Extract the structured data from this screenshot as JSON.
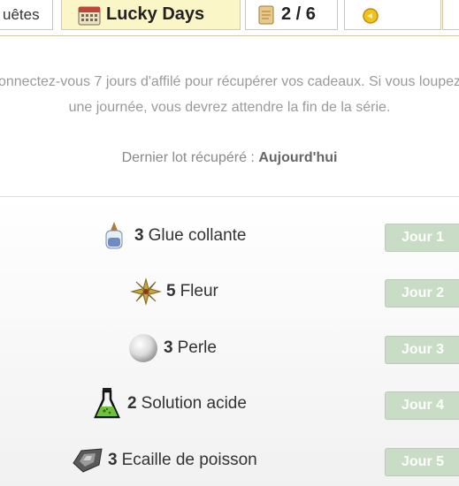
{
  "tabs": {
    "quetes": "uêtes",
    "lucky": "Lucky Days",
    "count": "2 / 6"
  },
  "info": {
    "description": "onnectez-vous 7 jours d'affilé pour récupérer vos cadeaux. Si vous loupez une journée, vous devrez attendre la fin de la série.",
    "last_claim_label": "Dernier lot récupéré :",
    "last_claim_value": "Aujourd'hui"
  },
  "rewards": [
    {
      "qty": "3",
      "name": "Glue collante",
      "day": "Jour 1",
      "icon": "glue-icon"
    },
    {
      "qty": "5",
      "name": "Fleur",
      "day": "Jour 2",
      "icon": "flower-icon"
    },
    {
      "qty": "3",
      "name": "Perle",
      "day": "Jour 3",
      "icon": "pearl-icon"
    },
    {
      "qty": "2",
      "name": "Solution acide",
      "day": "Jour 4",
      "icon": "flask-icon"
    },
    {
      "qty": "3",
      "name": "Ecaille de poisson",
      "day": "Jour 5",
      "icon": "fish-scale-icon"
    }
  ],
  "colors": {
    "active_tab_bg": "#fbf6c8",
    "day_button_bg": "#c9dcc5",
    "info_text": "#9a9a9a"
  }
}
